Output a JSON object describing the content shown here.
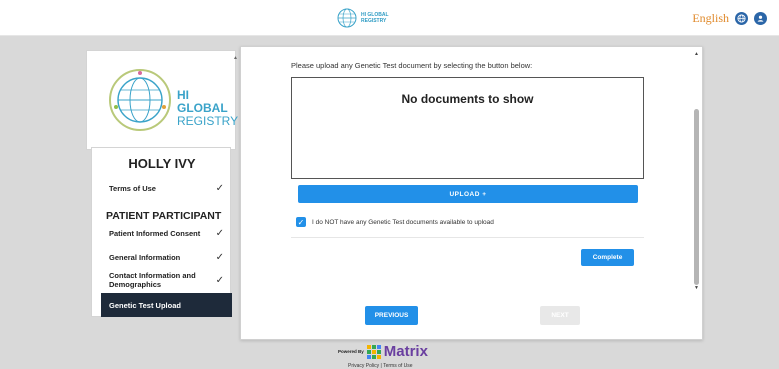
{
  "header": {
    "logo_line1": "HI GLOBAL",
    "logo_line2": "REGISTRY",
    "language": "English"
  },
  "sidebar": {
    "brand_line1": "HI GLOBAL",
    "brand_line2": "REGISTRY",
    "patient_name": "HOLLY IVY",
    "terms_label": "Terms of Use",
    "section_heading": "PATIENT PARTICIPANT",
    "items": [
      {
        "label": "Patient Informed Consent",
        "done": true
      },
      {
        "label": "General Information",
        "done": true
      },
      {
        "label": "Contact Information and Demographics",
        "done": true
      },
      {
        "label": "Genetic Test Upload",
        "done": false
      }
    ],
    "check_glyph": "✓"
  },
  "main": {
    "instruction": "Please upload any Genetic Test document by selecting the button below:",
    "empty_message": "No documents to show",
    "upload_label": "UPLOAD +",
    "checkbox_label": "I do NOT have any Genetic Test documents available to upload",
    "checkbox_checked": true,
    "complete_label": "Complete",
    "previous_label": "PREVIOUS",
    "next_label": "NEXT"
  },
  "footer": {
    "powered_by": "Powered By",
    "brand": "Matrix",
    "links": "Privacy Policy | Terms of Use"
  },
  "colors": {
    "accent": "#2290e8",
    "nav_active": "#1e2a3a",
    "brand_teal": "#3aa3c9",
    "language": "#e08a2b"
  }
}
